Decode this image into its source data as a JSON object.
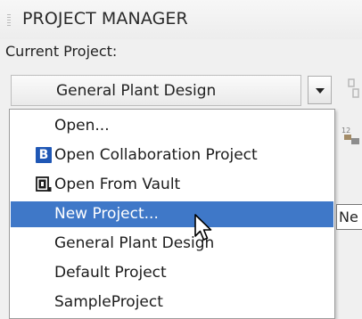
{
  "panel": {
    "title": "PROJECT MANAGER",
    "current_project_label": "Current Project:"
  },
  "combo": {
    "selected_value": "General Plant Design"
  },
  "dropdown": {
    "items": [
      {
        "label": "Open...",
        "icon": ""
      },
      {
        "label": "Open Collaboration Project",
        "icon": "collaboration-b-icon"
      },
      {
        "label": "Open From Vault",
        "icon": "vault-icon"
      },
      {
        "label": "New Project...",
        "icon": "",
        "selected": true
      },
      {
        "label": "General Plant Design",
        "icon": ""
      },
      {
        "label": "Default Project",
        "icon": ""
      },
      {
        "label": "SampleProject",
        "icon": ""
      }
    ]
  },
  "icons": {
    "b_glyph": "B"
  },
  "tooltip": {
    "text": "Ne"
  },
  "colors": {
    "selection": "#3f78c8",
    "collab_icon": "#1f57b5"
  }
}
